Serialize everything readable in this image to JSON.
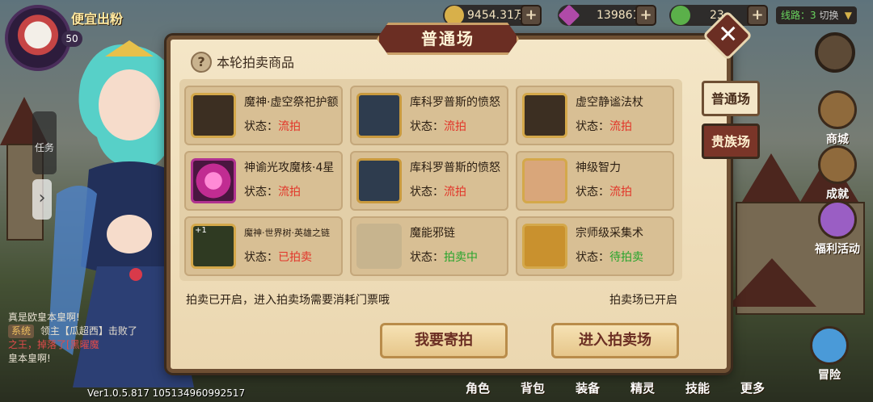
{
  "hud": {
    "player_name": "便宜出粉",
    "level": "50",
    "gold": "9454.31万",
    "gems": "139861",
    "stamina": "23",
    "line_label": "线路：3",
    "line_switch": "切换"
  },
  "modal": {
    "title": "普通场",
    "section_title": "本轮拍卖商品",
    "items": [
      {
        "name": "魔神·虚空祭祀护额",
        "status_label": "状态：",
        "status": "流拍",
        "status_kind": "flow"
      },
      {
        "name": "库科罗普斯的愤怒",
        "status_label": "状态：",
        "status": "流拍",
        "status_kind": "flow"
      },
      {
        "name": "虚空静谧法杖",
        "status_label": "状态：",
        "status": "流拍",
        "status_kind": "flow"
      },
      {
        "name": "神谕光攻魔核·4星",
        "status_label": "状态：",
        "status": "流拍",
        "status_kind": "flow"
      },
      {
        "name": "库科罗普斯的愤怒",
        "status_label": "状态：",
        "status": "流拍",
        "status_kind": "flow"
      },
      {
        "name": "神级智力",
        "status_label": "状态：",
        "status": "流拍",
        "status_kind": "flow"
      },
      {
        "name": "魔神·世界树·英雄之链",
        "status_label": "状态：",
        "status": "已拍卖",
        "status_kind": "sold",
        "badge": "+1"
      },
      {
        "name": "魔能邪链",
        "status_label": "状态：",
        "status": "拍卖中",
        "status_kind": "live"
      },
      {
        "name": "宗师级采集术",
        "status_label": "状态：",
        "status": "待拍卖",
        "status_kind": "wait"
      }
    ],
    "note_left": "拍卖已开启，进入拍卖场需要消耗门票哦",
    "note_right": "拍卖场已开启",
    "btn_consign": "我要寄拍",
    "btn_enter": "进入拍卖场",
    "tab_normal": "普通场",
    "tab_noble": "贵族场",
    "close": "✕"
  },
  "side": {
    "task": "任务",
    "shop": "商城",
    "achievement": "成就",
    "welfare": "福利活动",
    "adventure": "冒险"
  },
  "bottom": {
    "role": "角色",
    "bag": "背包",
    "equip": "装备",
    "spirit": "精灵",
    "skill": "技能",
    "more": "更多"
  },
  "chat": {
    "line1": "真是欧皇本皇啊!",
    "sys_tag": "系统",
    "line2a": "领主【瓜超西】击败了",
    "line2b": "之王，掉落了[黑曜魔",
    "line3": "皇本皇啊!"
  },
  "version": "Ver1.0.5.817 105134960992517"
}
